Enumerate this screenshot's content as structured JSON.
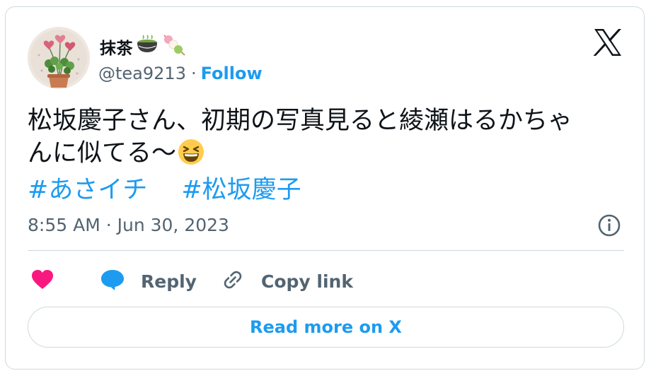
{
  "author": {
    "display_name": "抹茶",
    "display_name_emojis": [
      "matcha-tea-emoji",
      "dango-emoji"
    ],
    "handle": "@tea9213",
    "separator": "·",
    "follow_label": "Follow"
  },
  "tweet": {
    "line1": "松坂慶子さん、初期の写真見ると綾瀬はるかちゃ",
    "line2": "んに似てる〜",
    "line2_emoji": "grinning-squinting-face-emoji",
    "hashtags": [
      "#あさイチ",
      "#松坂慶子"
    ]
  },
  "timestamp": "8:55 AM · Jun 30, 2023",
  "actions": {
    "like_icon": "heart-icon",
    "reply_label": "Reply",
    "copy_label": "Copy link"
  },
  "read_more_label": "Read more on X",
  "colors": {
    "accent": "#1d9bf0",
    "like": "#f91880",
    "text": "#0f1419",
    "secondary": "#536471",
    "border": "#cfd9de"
  }
}
